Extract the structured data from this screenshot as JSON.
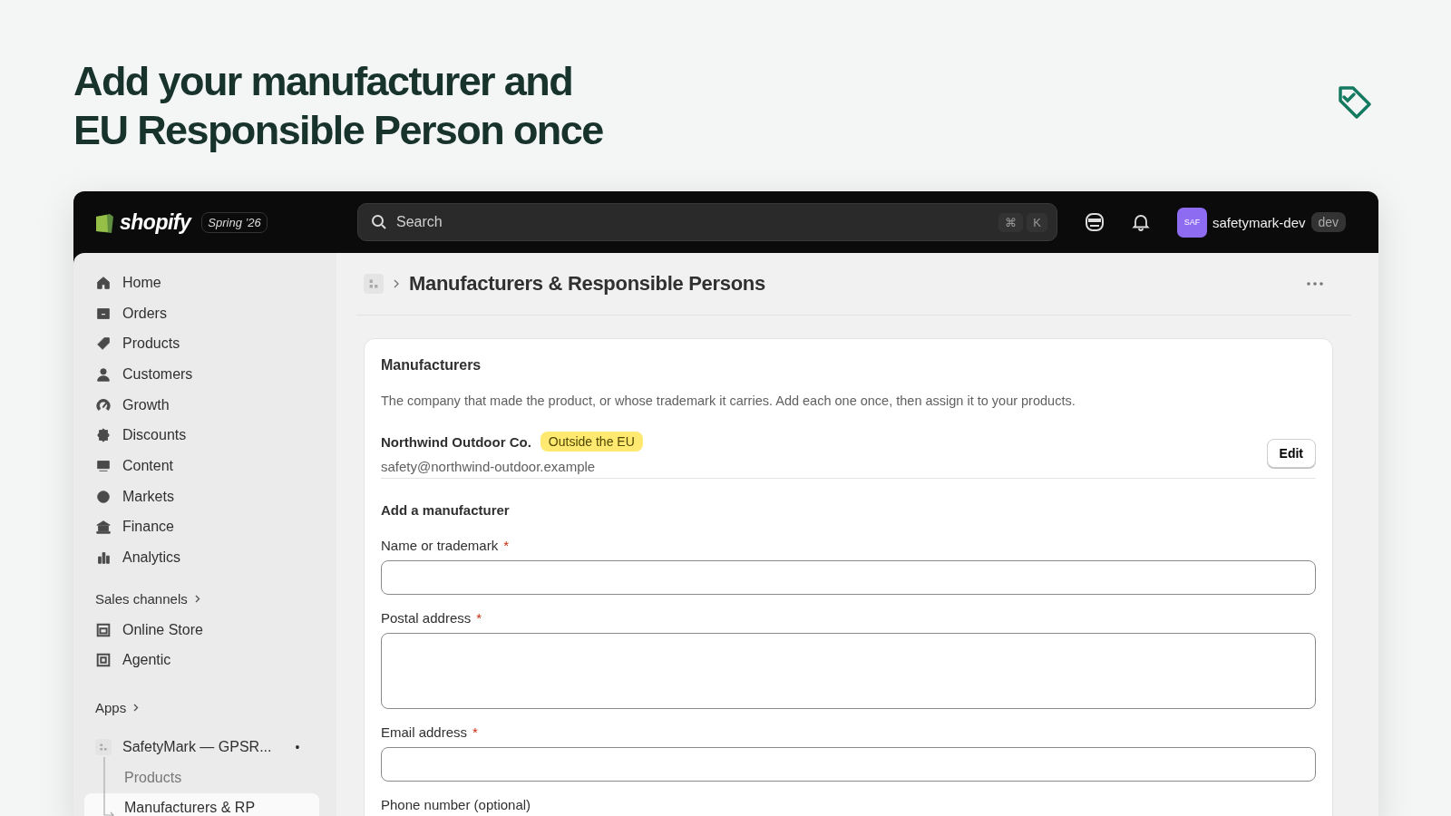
{
  "headline": [
    "Add your manufacturer and",
    "EU Responsible Person once"
  ],
  "topbar": {
    "brand": "shopify",
    "edition": "Spring ’26",
    "search": {
      "placeholder": "Search",
      "keys": [
        "⌘",
        "K"
      ]
    },
    "avatar": "SAF",
    "store": "safetymark-dev",
    "store_tag": "dev"
  },
  "sidebar": {
    "items": [
      {
        "label": "Home",
        "selected": false
      },
      {
        "label": "Orders",
        "selected": false
      },
      {
        "label": "Products",
        "selected": false
      },
      {
        "label": "Customers",
        "selected": false
      },
      {
        "label": "Growth",
        "selected": false
      },
      {
        "label": "Discounts",
        "selected": false
      },
      {
        "label": "Content",
        "selected": false
      },
      {
        "label": "Markets",
        "selected": false
      },
      {
        "label": "Finance",
        "selected": false
      },
      {
        "label": "Analytics",
        "selected": false
      }
    ],
    "sales_channels": {
      "title": "Sales channels",
      "items": [
        {
          "label": "Online Store",
          "selected": false
        },
        {
          "label": "Agentic",
          "selected": false
        }
      ]
    },
    "apps": {
      "title": "Apps",
      "app": {
        "label": "SafetyMark — GPSR...",
        "dot": "•",
        "children": [
          {
            "label": "Products",
            "selected": false
          },
          {
            "label": "Manufacturers & RP",
            "selected": true
          }
        ]
      }
    }
  },
  "page": {
    "title": "Manufacturers & Responsible Persons",
    "card": {
      "title": "Manufacturers",
      "description": "The company that made the product, or whose trademark it carries. Add each one once, then assign it to your products.",
      "entries": [
        {
          "name": "Northwind Outdoor Co.",
          "badge": "Outside the EU",
          "email": "safety@northwind-outdoor.example",
          "action": "Edit"
        }
      ],
      "form_title": "Add a manufacturer",
      "fields": [
        {
          "label": "Name or trademark",
          "required_mark": "*",
          "kind": "input"
        },
        {
          "label": "Postal address",
          "required_mark": "*",
          "kind": "textarea"
        },
        {
          "label": "Email address",
          "required_mark": "*",
          "kind": "input"
        },
        {
          "label": "Phone number (optional)",
          "kind": "label_only"
        }
      ]
    }
  }
}
